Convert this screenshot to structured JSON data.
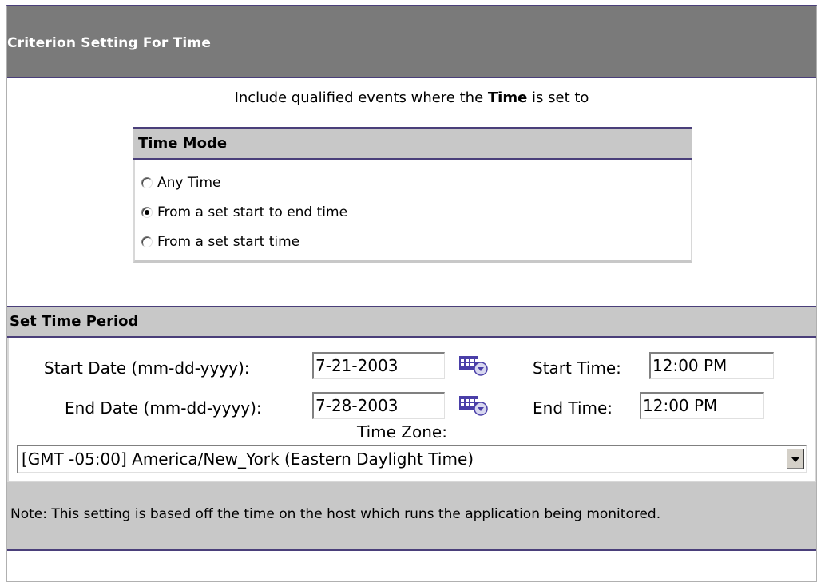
{
  "title": "Criterion Setting For Time",
  "intro": {
    "prefix": "Include qualified events where the ",
    "emphasis": "Time",
    "suffix": " is set to"
  },
  "time_mode": {
    "header": "Time Mode",
    "options": [
      {
        "label": "Any Time",
        "checked": false
      },
      {
        "label": "From a set start to end time",
        "checked": true
      },
      {
        "label": "From a set start time",
        "checked": false
      }
    ]
  },
  "period": {
    "header": "Set Time Period",
    "start_date_label": "Start Date (mm-dd-yyyy):",
    "start_date_value": "7-21-2003",
    "end_date_label": "End Date (mm-dd-yyyy):",
    "end_date_value": "7-28-2003",
    "start_time_label": "Start Time:",
    "start_time_value": "12:00 PM",
    "end_time_label": "End Time:",
    "end_time_value": "12:00 PM",
    "timezone_label": "Time Zone:",
    "timezone_value": "[GMT -05:00] America/New_York (Eastern Daylight Time)",
    "note": "Note: This setting is based off the time on the host which runs the application being monitored."
  },
  "colors": {
    "title_bg": "#7a7a7a",
    "header_bg": "#c8c8c8",
    "rule": "#4a3f7a",
    "calendar_icon": "#4a3fa8"
  },
  "icons": [
    "calendar-icon",
    "dropdown-arrow-icon",
    "radio-icon"
  ]
}
